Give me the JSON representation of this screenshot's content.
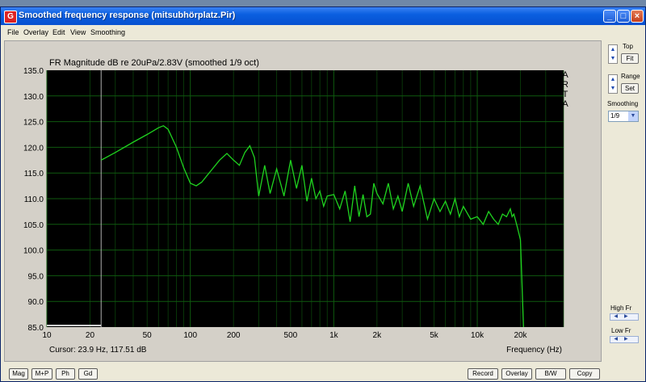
{
  "window": {
    "title": "Smoothed frequency response (mitsubhörplatz.Pir)",
    "app_icon": "arta-icon",
    "controls": {
      "minimize": "_",
      "maximize": "□",
      "close": "×"
    }
  },
  "menu": [
    "File",
    "Overlay",
    "Edit",
    "View",
    "Smoothing"
  ],
  "plot": {
    "title": "FR Magnitude dB re 20uPa/2.83V (smoothed 1/9 oct)",
    "watermark": [
      "A",
      "R",
      "T",
      "A"
    ],
    "cursor_readout": "Cursor: 23.9 Hz, 117.51 dB",
    "colors": {
      "background": "#000000",
      "trace": "#1fd31f",
      "grid": "#0f5a0f",
      "cursor": "#b0b0b0"
    }
  },
  "chart_data": {
    "type": "line",
    "title": "FR Magnitude dB re 20uPa/2.83V (smoothed 1/9 oct)",
    "xlabel": "Frequency (Hz)",
    "ylabel": "",
    "xscale": "log",
    "xlim": [
      10,
      40000
    ],
    "ylim": [
      85,
      135
    ],
    "grid": true,
    "x_ticks": [
      "10",
      "20",
      "50",
      "100",
      "200",
      "500",
      "1k",
      "2k",
      "5k",
      "10k",
      "20k"
    ],
    "y_ticks": [
      "135.0",
      "130.0",
      "125.0",
      "120.0",
      "115.0",
      "110.0",
      "105.0",
      "100.0",
      "95.0",
      "90.0",
      "85.0"
    ],
    "cursor_x": 23.9,
    "series": [
      {
        "x": [
          23.9,
          30,
          40,
          50,
          60,
          65,
          70,
          80,
          90,
          100,
          110,
          120,
          140,
          160,
          180,
          200,
          220,
          240,
          260,
          280,
          300,
          330,
          360,
          400,
          450,
          500,
          550,
          600,
          650,
          700,
          750,
          800,
          850,
          900,
          1000,
          1100,
          1200,
          1300,
          1400,
          1500,
          1600,
          1700,
          1800,
          1900,
          2000,
          2200,
          2400,
          2600,
          2800,
          3000,
          3300,
          3600,
          4000,
          4500,
          5000,
          5500,
          6000,
          6500,
          7000,
          7500,
          8000,
          9000,
          10000,
          11000,
          12000,
          13000,
          14000,
          15000,
          16000,
          17000,
          17500,
          18000,
          19000,
          20000,
          21000
        ],
        "y": [
          117.5,
          119.0,
          121.0,
          122.5,
          123.8,
          124.2,
          123.5,
          120.0,
          116.0,
          113.0,
          112.5,
          113.2,
          115.5,
          117.5,
          118.8,
          117.5,
          116.5,
          119.0,
          120.3,
          118.0,
          110.5,
          116.5,
          111.0,
          115.8,
          110.5,
          117.5,
          112.0,
          116.5,
          109.5,
          114.0,
          110.0,
          111.5,
          108.5,
          110.5,
          110.8,
          108.0,
          111.5,
          105.5,
          112.5,
          106.5,
          110.8,
          106.5,
          107.0,
          113.0,
          111.0,
          109.0,
          113.0,
          108.0,
          110.5,
          107.5,
          113.0,
          108.5,
          112.5,
          106.0,
          110.0,
          107.5,
          109.5,
          107.0,
          110.0,
          106.5,
          108.5,
          106.0,
          106.5,
          105.0,
          107.5,
          106.0,
          105.0,
          107.0,
          106.5,
          108.0,
          106.5,
          107.0,
          104.5,
          102.0,
          85.0
        ]
      }
    ]
  },
  "side": {
    "top_label": "Top",
    "fit_label": "Fit",
    "range_label": "Range",
    "set_label": "Set",
    "smoothing_label": "Smoothing",
    "smoothing_value": "1/9",
    "high_fr_label": "High Fr",
    "low_fr_label": "Low Fr"
  },
  "buttons_left": [
    "Mag",
    "M+P",
    "Ph",
    "Gd"
  ],
  "buttons_right": [
    "Record",
    "Overlay",
    "B/W",
    "Copy"
  ]
}
